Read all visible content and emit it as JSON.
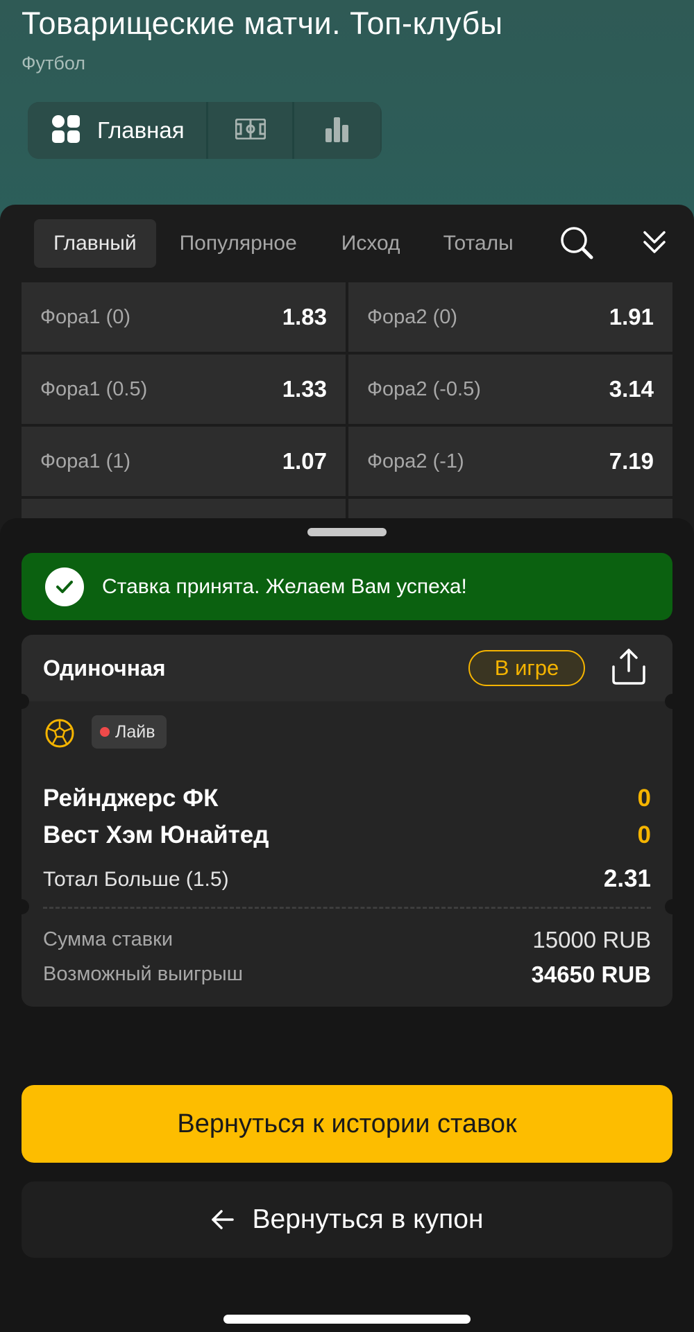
{
  "header": {
    "title": "Товарищеские матчи. Топ-клубы",
    "subtitle": "Футбол",
    "view_switcher": {
      "main_label": "Главная",
      "icons": [
        "grid-icon",
        "field-icon",
        "stats-icon"
      ]
    }
  },
  "market_tabs": {
    "tabs": [
      {
        "label": "Главный",
        "active": true
      },
      {
        "label": "Популярное",
        "active": false
      },
      {
        "label": "Исход",
        "active": false
      },
      {
        "label": "Тоталы",
        "active": false
      }
    ],
    "icons": [
      "search-icon",
      "collapse-icon"
    ]
  },
  "odds": [
    [
      {
        "name": "Фора1 (0)",
        "value": "1.83"
      },
      {
        "name": "Фора2 (0)",
        "value": "1.91"
      }
    ],
    [
      {
        "name": "Фора1 (0.5)",
        "value": "1.33"
      },
      {
        "name": "Фора2 (-0.5)",
        "value": "3.14"
      }
    ],
    [
      {
        "name": "Фора1 (1)",
        "value": "1.07"
      },
      {
        "name": "Фора2 (-1)",
        "value": "7.19"
      }
    ]
  ],
  "confirmation": {
    "message": "Ставка принята. Желаем Вам успеха!"
  },
  "bet": {
    "type": "Одиночная",
    "status": "В игре",
    "live_label": "Лайв",
    "team1": {
      "name": "Рейнджерс ФК",
      "score": "0"
    },
    "team2": {
      "name": "Вест Хэм Юнайтед",
      "score": "0"
    },
    "market": "Тотал Больше (1.5)",
    "odd": "2.31",
    "stake_label": "Сумма ставки",
    "stake_value": "15000 RUB",
    "win_label": "Возможный выигрыш",
    "win_value": "34650 RUB"
  },
  "actions": {
    "history_button": "Вернуться к истории ставок",
    "coupon_button": "Вернуться в купон"
  },
  "colors": {
    "accent": "#fdbd00",
    "success": "#0b6110",
    "header_bg": "#2f5a55",
    "live": "#f04a4a"
  }
}
